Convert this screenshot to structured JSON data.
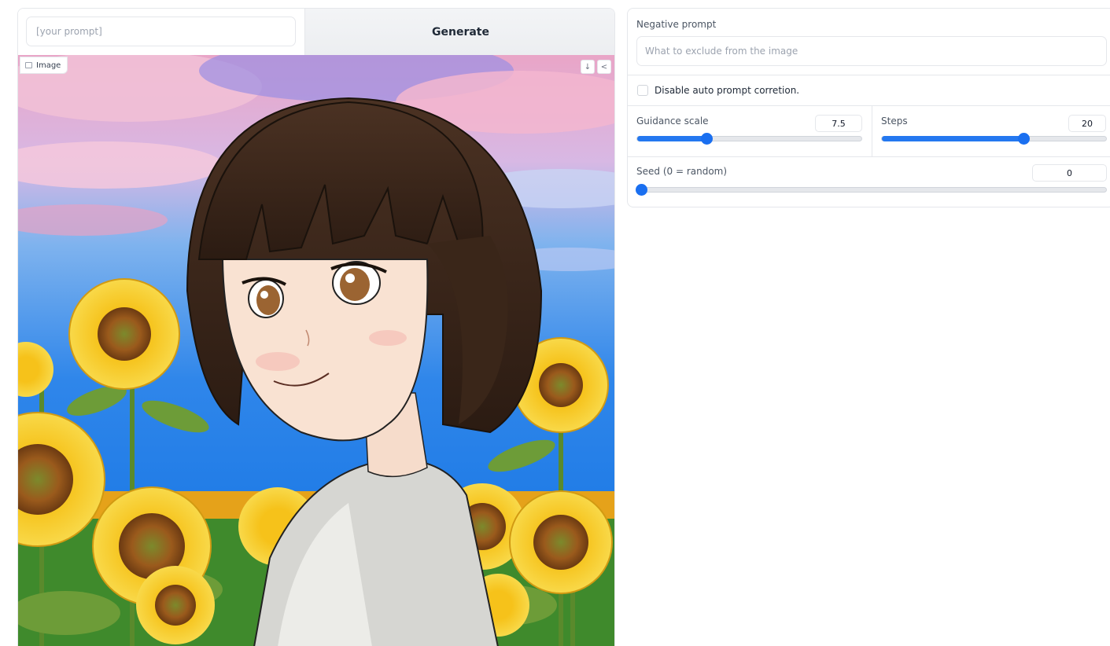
{
  "prompt": {
    "placeholder": "[your prompt]",
    "value": ""
  },
  "generate_button": {
    "label": "Generate"
  },
  "image_panel": {
    "label": "Image",
    "download_icon": "download-icon",
    "share_icon": "share-icon"
  },
  "negative_prompt": {
    "label": "Negative prompt",
    "placeholder": "What to exclude from the image",
    "value": ""
  },
  "auto_correct": {
    "label": "Disable auto prompt corretion.",
    "checked": false
  },
  "guidance_scale": {
    "label": "Guidance scale",
    "value": "7.5",
    "fraction": 0.31
  },
  "steps": {
    "label": "Steps",
    "value": "20",
    "fraction": 0.63
  },
  "seed": {
    "label": "Seed (0 = random)",
    "value": "0",
    "fraction": 0.0
  },
  "colors": {
    "accent": "#2478f0",
    "border": "#e5e7eb"
  }
}
